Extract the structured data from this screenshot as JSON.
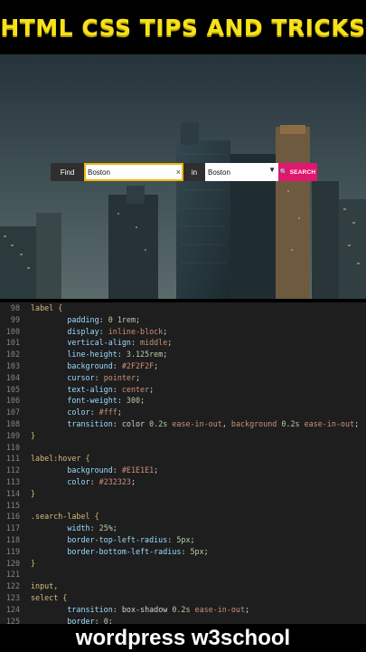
{
  "title": "HTML CSS TIPS AND TRICKS",
  "search_form": {
    "find_label": "Find",
    "query_value": "Boston",
    "clear_glyph": "×",
    "in_label": "in",
    "location_value": "Boston",
    "search_label": "SEARCH"
  },
  "icons": [
    "clear-icon",
    "dropdown-arrow-icon",
    "magnifier-icon"
  ],
  "colors": {
    "title": "#f6e21a",
    "label_bg": "#2f2f2f",
    "focus_border": "#f1b400",
    "search_button": "#e1166f",
    "code_bg": "#1e1e1e"
  },
  "code_lines": [
    {
      "n": "98",
      "t": [
        [
          "sel",
          "label {"
        ]
      ]
    },
    {
      "n": "99",
      "t": [
        [
          "pun",
          "        "
        ],
        [
          "prop",
          "padding"
        ],
        [
          "pun",
          ": "
        ],
        [
          "num",
          "0 1rem"
        ],
        [
          "pun",
          ";"
        ]
      ]
    },
    {
      "n": "100",
      "t": [
        [
          "pun",
          "        "
        ],
        [
          "prop",
          "display"
        ],
        [
          "pun",
          ": "
        ],
        [
          "val",
          "inline-block"
        ],
        [
          "pun",
          ";"
        ]
      ]
    },
    {
      "n": "101",
      "t": [
        [
          "pun",
          "        "
        ],
        [
          "prop",
          "vertical-align"
        ],
        [
          "pun",
          ": "
        ],
        [
          "val",
          "middle"
        ],
        [
          "pun",
          ";"
        ]
      ]
    },
    {
      "n": "102",
      "t": [
        [
          "pun",
          "        "
        ],
        [
          "prop",
          "line-height"
        ],
        [
          "pun",
          ": "
        ],
        [
          "num",
          "3.125rem"
        ],
        [
          "pun",
          ";"
        ]
      ]
    },
    {
      "n": "103",
      "t": [
        [
          "pun",
          "        "
        ],
        [
          "prop",
          "background"
        ],
        [
          "pun",
          ": "
        ],
        [
          "val",
          "#2F2F2F"
        ],
        [
          "pun",
          ";"
        ]
      ]
    },
    {
      "n": "104",
      "t": [
        [
          "pun",
          "        "
        ],
        [
          "prop",
          "cursor"
        ],
        [
          "pun",
          ": "
        ],
        [
          "val",
          "pointer"
        ],
        [
          "pun",
          ";"
        ]
      ]
    },
    {
      "n": "105",
      "t": [
        [
          "pun",
          "        "
        ],
        [
          "prop",
          "text-align"
        ],
        [
          "pun",
          ": "
        ],
        [
          "val",
          "center"
        ],
        [
          "pun",
          ";"
        ]
      ]
    },
    {
      "n": "106",
      "t": [
        [
          "pun",
          "        "
        ],
        [
          "prop",
          "font-weight"
        ],
        [
          "pun",
          ": "
        ],
        [
          "num",
          "300"
        ],
        [
          "pun",
          ";"
        ]
      ]
    },
    {
      "n": "107",
      "t": [
        [
          "pun",
          "        "
        ],
        [
          "prop",
          "color"
        ],
        [
          "pun",
          ": "
        ],
        [
          "val",
          "#fff"
        ],
        [
          "pun",
          ";"
        ]
      ]
    },
    {
      "n": "108",
      "t": [
        [
          "pun",
          "        "
        ],
        [
          "prop",
          "transition"
        ],
        [
          "pun",
          ": "
        ],
        [
          "pun",
          "color "
        ],
        [
          "num",
          "0.2s"
        ],
        [
          "val",
          " ease-in-out"
        ],
        [
          "pun",
          ", "
        ],
        [
          "val",
          "background"
        ],
        [
          "pun",
          " "
        ],
        [
          "num",
          "0.2s"
        ],
        [
          "val",
          " ease-in-out"
        ],
        [
          "pun",
          ";"
        ]
      ]
    },
    {
      "n": "109",
      "t": [
        [
          "sel",
          "}"
        ]
      ]
    },
    {
      "n": "110",
      "t": [
        [
          "pun",
          ""
        ]
      ]
    },
    {
      "n": "111",
      "t": [
        [
          "sel",
          "label:hover {"
        ]
      ]
    },
    {
      "n": "112",
      "t": [
        [
          "pun",
          "        "
        ],
        [
          "prop",
          "background"
        ],
        [
          "pun",
          ": "
        ],
        [
          "val",
          "#E1E1E1"
        ],
        [
          "pun",
          ";"
        ]
      ]
    },
    {
      "n": "113",
      "t": [
        [
          "pun",
          "        "
        ],
        [
          "prop",
          "color"
        ],
        [
          "pun",
          ": "
        ],
        [
          "val",
          "#232323"
        ],
        [
          "pun",
          ";"
        ]
      ]
    },
    {
      "n": "114",
      "t": [
        [
          "sel",
          "}"
        ]
      ]
    },
    {
      "n": "115",
      "t": [
        [
          "pun",
          ""
        ]
      ]
    },
    {
      "n": "116",
      "t": [
        [
          "sel",
          ".search-label {"
        ]
      ]
    },
    {
      "n": "117",
      "t": [
        [
          "pun",
          "        "
        ],
        [
          "prop",
          "width"
        ],
        [
          "pun",
          ": "
        ],
        [
          "num",
          "25%"
        ],
        [
          "pun",
          ";"
        ]
      ]
    },
    {
      "n": "118",
      "t": [
        [
          "pun",
          "        "
        ],
        [
          "prop",
          "border-top-left-radius"
        ],
        [
          "pun",
          ": "
        ],
        [
          "num",
          "5px"
        ],
        [
          "pun",
          ";"
        ]
      ]
    },
    {
      "n": "119",
      "t": [
        [
          "pun",
          "        "
        ],
        [
          "prop",
          "border-bottom-left-radius"
        ],
        [
          "pun",
          ": "
        ],
        [
          "num",
          "5px"
        ],
        [
          "pun",
          ";"
        ]
      ]
    },
    {
      "n": "120",
      "t": [
        [
          "sel",
          "}"
        ]
      ]
    },
    {
      "n": "121",
      "t": [
        [
          "pun",
          ""
        ]
      ]
    },
    {
      "n": "122",
      "t": [
        [
          "sel",
          "input,"
        ]
      ]
    },
    {
      "n": "123",
      "t": [
        [
          "sel",
          "select {"
        ]
      ]
    },
    {
      "n": "124",
      "t": [
        [
          "pun",
          "        "
        ],
        [
          "prop",
          "transition"
        ],
        [
          "pun",
          ": "
        ],
        [
          "pun",
          "box-shadow "
        ],
        [
          "num",
          "0.2s"
        ],
        [
          "val",
          " ease-in-out"
        ],
        [
          "pun",
          ";"
        ]
      ]
    },
    {
      "n": "125",
      "t": [
        [
          "pun",
          "        "
        ],
        [
          "prop",
          "border"
        ],
        [
          "pun",
          ": "
        ],
        [
          "num",
          "0"
        ],
        [
          "pun",
          ";"
        ]
      ]
    }
  ],
  "footer": "wordpress w3school"
}
